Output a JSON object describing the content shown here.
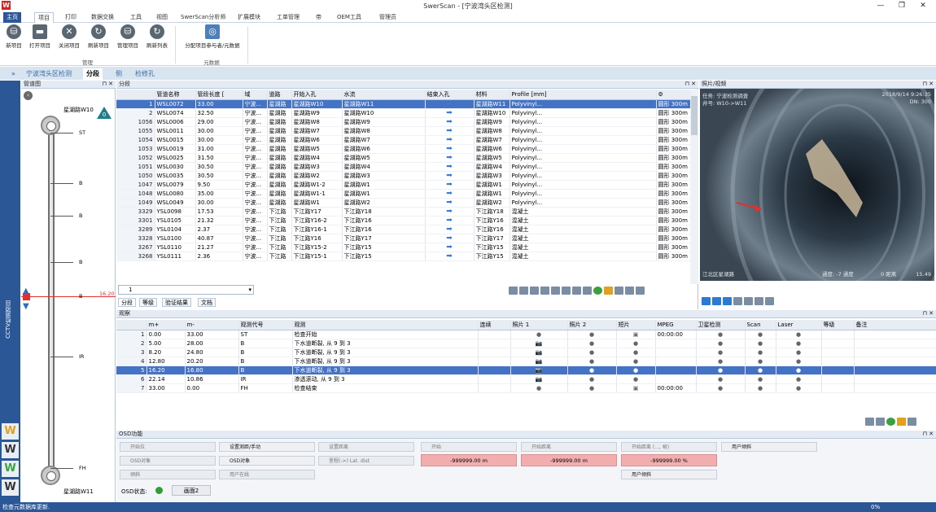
{
  "window": {
    "title": "SwerScan - [宁波湾头区检测]"
  },
  "menu": [
    "主页",
    "项目",
    "打印",
    "数据交换",
    "工具",
    "视图",
    "SwerScan分析师",
    "扩展模块",
    "工单管理",
    "帝",
    "OEM工具",
    "管理员"
  ],
  "ribbon": {
    "buttons": [
      "新项目",
      "打开项目",
      "关闭项目",
      "刷新项目",
      "管理项目",
      "刷新列表",
      "分配项目参与者/元数据"
    ],
    "groups": [
      "管理",
      "元数据"
    ]
  },
  "doctabs": [
    "宁波湾头区检测",
    "分段",
    "侧",
    "检修孔"
  ],
  "left_strip": {
    "label": "CCTV检测项目"
  },
  "pipe_panel": {
    "title": "管道图",
    "top_node": "星湖路W10",
    "bottom_node": "星湖路W11",
    "badge": "0",
    "markers": [
      {
        "code": "ST"
      },
      {
        "code": "B"
      },
      {
        "code": "B"
      },
      {
        "code": "B"
      },
      {
        "code": "B",
        "distance": "16.20"
      },
      {
        "code": "IR"
      },
      {
        "code": "FH"
      }
    ]
  },
  "segments": {
    "title": "分段",
    "columns": [
      "管道名称",
      "管段长度 [",
      "域",
      "道路",
      "开始入孔",
      "水流",
      "结束入孔",
      "材料",
      "Profile [mm]"
    ],
    "rows": [
      [
        "1",
        "WSL0072",
        "33.00",
        "宁波...",
        "星湖路",
        "星湖路W10",
        "星湖路W11",
        "Polyvinyl...",
        "圆形 300m"
      ],
      [
        "2",
        "WSL0074",
        "32.50",
        "宁波...",
        "星湖路",
        "星湖路W9",
        "星湖路W10",
        "Polyvinyl...",
        "圆形 300m"
      ],
      [
        "1056",
        "WSL0006",
        "29.00",
        "宁波...",
        "星湖路",
        "星湖路W8",
        "星湖路W9",
        "Polyvinyl...",
        "圆形 300m"
      ],
      [
        "1055",
        "WSL0011",
        "30.00",
        "宁波...",
        "星湖路",
        "星湖路W7",
        "星湖路W8",
        "Polyvinyl...",
        "圆形 300m"
      ],
      [
        "1054",
        "WSL0015",
        "30.00",
        "宁波...",
        "星湖路",
        "星湖路W6",
        "星湖路W7",
        "Polyvinyl...",
        "圆形 300m"
      ],
      [
        "1053",
        "WSL0019",
        "31.00",
        "宁波...",
        "星湖路",
        "星湖路W5",
        "星湖路W6",
        "Polyvinyl...",
        "圆形 300m"
      ],
      [
        "1052",
        "WSL0025",
        "31.50",
        "宁波...",
        "星湖路",
        "星湖路W4",
        "星湖路W5",
        "Polyvinyl...",
        "圆形 300m"
      ],
      [
        "1051",
        "WSL0030",
        "30.50",
        "宁波...",
        "星湖路",
        "星湖路W3",
        "星湖路W4",
        "Polyvinyl...",
        "圆形 300m"
      ],
      [
        "1050",
        "WSL0035",
        "30.50",
        "宁波...",
        "星湖路",
        "星湖路W2",
        "星湖路W3",
        "Polyvinyl...",
        "圆形 300m"
      ],
      [
        "1047",
        "WSL0079",
        "9.50",
        "宁波...",
        "星湖路",
        "星湖路W1-2",
        "星湖路W1",
        "Polyvinyl...",
        "圆形 300m"
      ],
      [
        "1048",
        "WSL0080",
        "35.00",
        "宁波...",
        "星湖路",
        "星湖路W1-1",
        "星湖路W1",
        "Polyvinyl...",
        "圆形 300m"
      ],
      [
        "1049",
        "WSL0049",
        "30.00",
        "宁波...",
        "星湖路",
        "星湖路W1",
        "星湖路W2",
        "Polyvinyl...",
        "圆形 300m"
      ],
      [
        "3329",
        "YSL0098",
        "17.53",
        "宁波...",
        "下江路",
        "下江路Y17",
        "下江路Y18",
        "混凝土",
        "圆形 300m"
      ],
      [
        "3301",
        "YSL0105",
        "21.32",
        "宁波...",
        "下江路",
        "下江路Y16-2",
        "下江路Y16",
        "混凝土",
        "圆形 300m"
      ],
      [
        "3289",
        "YSL0104",
        "2.37",
        "宁波...",
        "下江路",
        "下江路Y16-1",
        "下江路Y16",
        "混凝土",
        "圆形 300m"
      ],
      [
        "3328",
        "YSL0100",
        "40.87",
        "宁波...",
        "下江路",
        "下江路Y16",
        "下江路Y17",
        "混凝土",
        "圆形 300m"
      ],
      [
        "3267",
        "YSL0110",
        "21.27",
        "宁波...",
        "下江路",
        "下江路Y15-2",
        "下江路Y15",
        "混凝土",
        "圆形 300m"
      ],
      [
        "3268",
        "YSL0111",
        "2.36",
        "宁波...",
        "下江路",
        "下江路Y15-1",
        "下江路Y15",
        "混凝土",
        "圆形 300m"
      ]
    ],
    "selector": "1",
    "tabs": [
      "分段",
      "等级",
      "验证结果",
      "文档"
    ]
  },
  "photo": {
    "title": "照片/视频",
    "overlay_left": "任务: 宁波检测调查",
    "overlay_left2": "井号: W10->W11",
    "date": "2018/9/14 9:26:35",
    "dn": "DN: 300",
    "bottom_left": "江北区星湖路",
    "bottom_mid": "通度: -7 通度",
    "bottom_dist": "0 距离",
    "bottom_right": "15.49"
  },
  "observations": {
    "title": "观察",
    "columns": [
      "m+",
      "m-",
      "观测代号",
      "观测",
      "连续",
      "照片 1",
      "照片 2",
      "短片",
      "MPEG",
      "卫星检测",
      "Scan",
      "Laser",
      "等级",
      "备注"
    ],
    "rows": [
      [
        "1",
        "0.00",
        "33.00",
        "ST",
        "检查开始",
        "",
        "●",
        "●",
        "▣",
        "00:00:00",
        "●",
        "●",
        "●"
      ],
      [
        "2",
        "5.00",
        "28.00",
        "B",
        "下水道断裂, 从 9 到 3",
        "",
        "📷",
        "●",
        "●",
        "",
        "●",
        "●",
        "●"
      ],
      [
        "3",
        "8.20",
        "24.80",
        "B",
        "下水道断裂, 从 9 到 3",
        "",
        "📷",
        "●",
        "●",
        "",
        "●",
        "●",
        "●"
      ],
      [
        "4",
        "12.80",
        "20.20",
        "B",
        "下水道断裂, 从 9 到 3",
        "",
        "📷",
        "●",
        "●",
        "",
        "●",
        "●",
        "●"
      ],
      [
        "5",
        "16.20",
        "16.80",
        "B",
        "下水道断裂, 从 9 到 3",
        "",
        "📷",
        "●",
        "●",
        "",
        "●",
        "●",
        "●"
      ],
      [
        "6",
        "22.14",
        "10.86",
        "IR",
        "渗透滚动, 从 9 到 3",
        "",
        "📷",
        "●",
        "●",
        "",
        "●",
        "●",
        "●"
      ],
      [
        "7",
        "33.00",
        "0.00",
        "FH",
        "检查结束",
        "",
        "●",
        "●",
        "▣",
        "00:00:00",
        "●",
        "●",
        "●"
      ]
    ]
  },
  "osd": {
    "title": "OSD功能",
    "buttons": [
      "开始位",
      "设置测距/手动",
      "设置距离",
      "开始",
      "开始距离",
      "开始距离 (..., 帧)",
      "用户倾斜",
      "OSD对象",
      "里程(->) Lat. dist",
      "倾斜",
      "用户在线",
      "用户倾斜"
    ],
    "values": [
      "-999999.00 m",
      "-999999.00 m",
      "-999999.00 %"
    ],
    "status_label": "OSD状态:",
    "scene_button": "画面2"
  },
  "status": {
    "text": "检查元数据库更新.",
    "percent": "0%"
  }
}
